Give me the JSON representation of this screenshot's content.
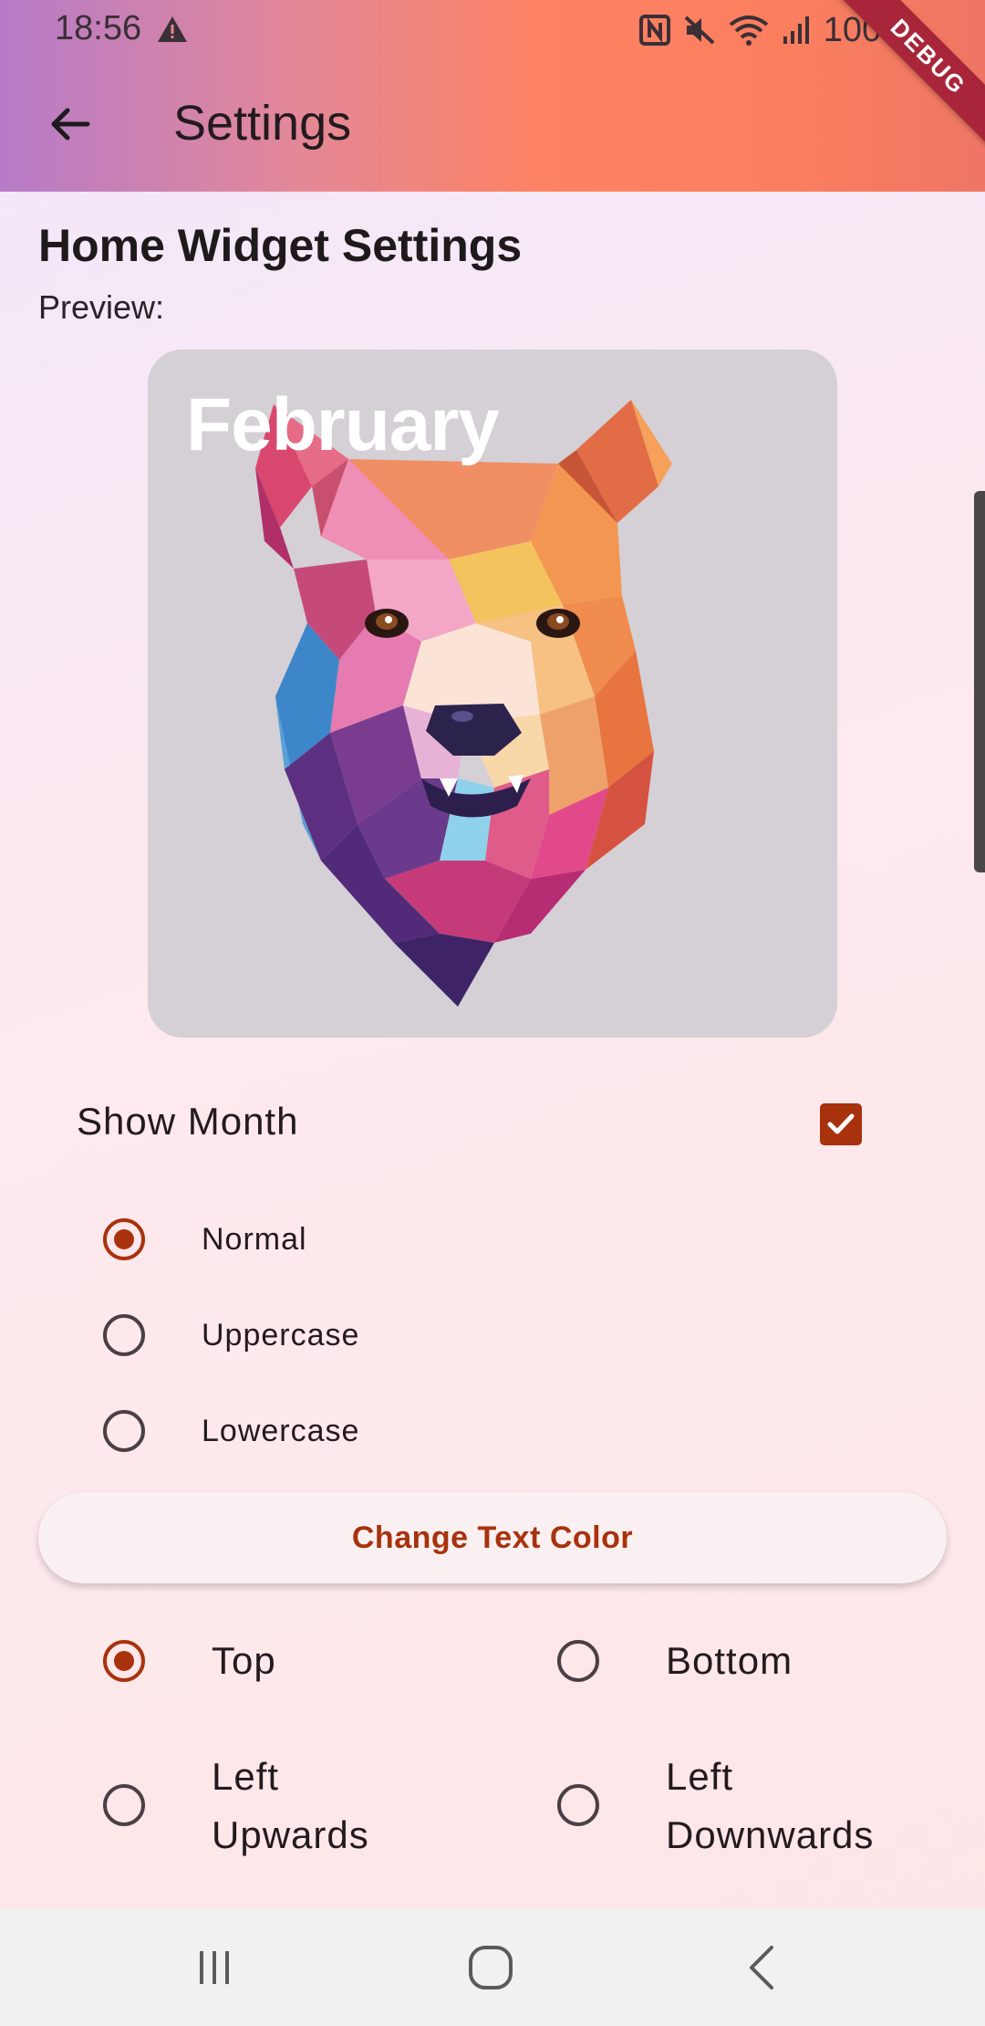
{
  "status_bar": {
    "time": "18:56",
    "battery": "100%"
  },
  "debug_ribbon": "DEBUG",
  "app_bar": {
    "title": "Settings"
  },
  "content": {
    "section_title": "Home Widget Settings",
    "preview_label": "Preview:",
    "preview_month": "February",
    "show_month": {
      "label": "Show Month",
      "checked": true
    },
    "case_options": [
      {
        "label": "Normal",
        "selected": true
      },
      {
        "label": "Uppercase",
        "selected": false
      },
      {
        "label": "Lowercase",
        "selected": false
      }
    ],
    "change_color_button": "Change Text Color",
    "position_options": [
      {
        "label": "Top",
        "selected": true
      },
      {
        "label": "Bottom",
        "selected": false
      },
      {
        "label": "Left Upwards",
        "line1": "Left",
        "line2": "Upwards",
        "selected": false
      },
      {
        "label": "Left Downwards",
        "line1": "Left",
        "line2": "Downwards",
        "selected": false
      }
    ]
  },
  "colors": {
    "accent": "#a8320d",
    "preview_bg": "#d4d0d5",
    "appbar_gradient": [
      "#b67bc9",
      "#fe8363",
      "#ef7664"
    ]
  },
  "icons": {
    "back": "arrow-back-icon",
    "warning": "warning-icon",
    "nfc": "nfc-icon",
    "mute": "mute-icon",
    "wifi": "wifi-icon",
    "signal": "signal-icon",
    "battery": "battery-icon",
    "nav_recents": "recents-icon",
    "nav_home": "home-icon",
    "nav_back": "nav-back-icon"
  }
}
